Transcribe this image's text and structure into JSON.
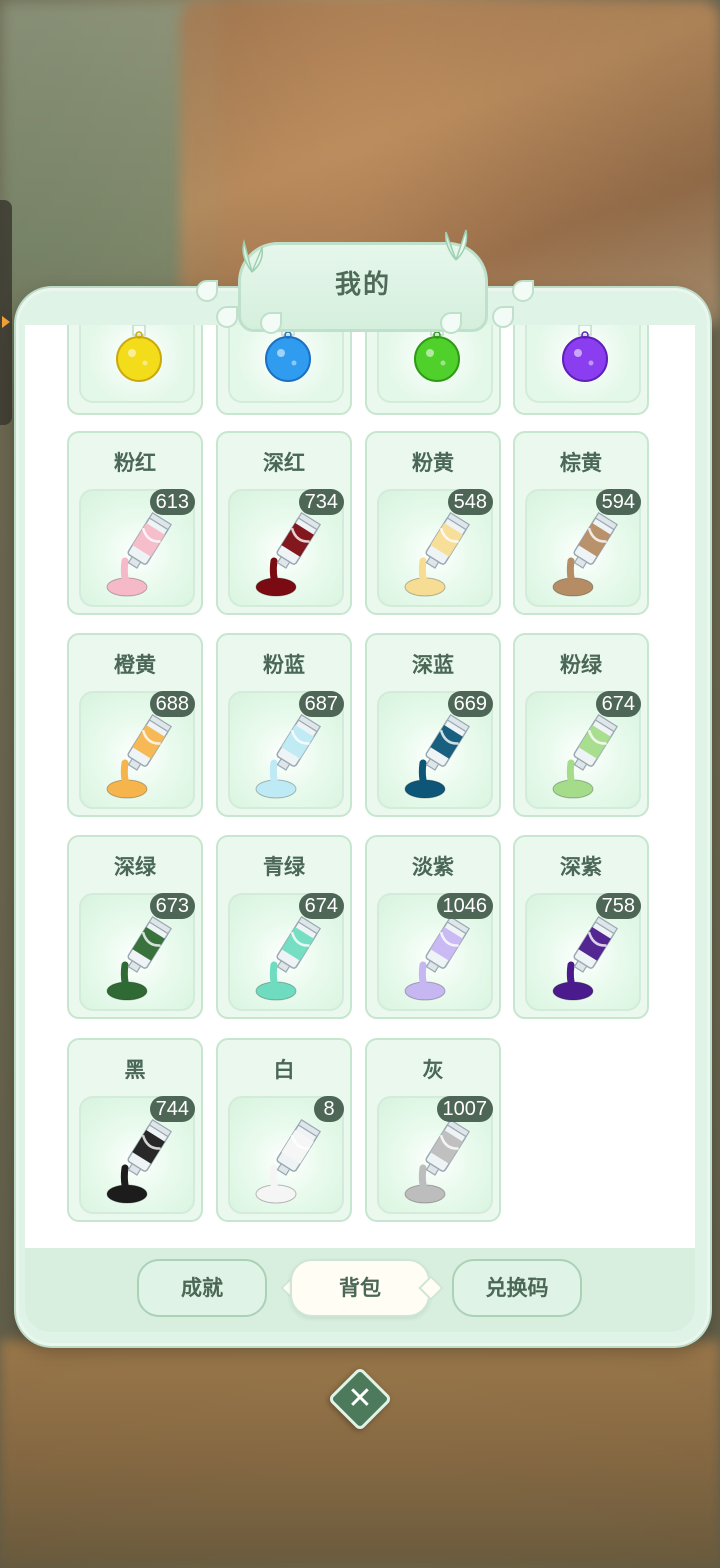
{
  "header": {
    "title": "我的"
  },
  "top_row": [
    {
      "icon": "yellow-potion-flask-icon",
      "color": "#f3dc1a",
      "dark": "#c9a90c"
    },
    {
      "icon": "blue-potion-flask-icon",
      "color": "#2f9cf0",
      "dark": "#1c6fc2"
    },
    {
      "icon": "green-potion-flask-icon",
      "color": "#4fd02a",
      "dark": "#2e9a16"
    },
    {
      "icon": "purple-potion-flask-icon",
      "color": "#8a3ef0",
      "dark": "#5e20b8"
    }
  ],
  "items": [
    {
      "label": "粉红",
      "count": "613",
      "icon": "pink-paint-tube-icon",
      "color": "#f6b9c8"
    },
    {
      "label": "深红",
      "count": "734",
      "icon": "dark-red-paint-tube-icon",
      "color": "#7b0b12"
    },
    {
      "label": "粉黄",
      "count": "548",
      "icon": "light-yellow-paint-tube-icon",
      "color": "#f7dc94"
    },
    {
      "label": "棕黄",
      "count": "594",
      "icon": "brown-yellow-paint-tube-icon",
      "color": "#b58c64"
    },
    {
      "label": "橙黄",
      "count": "688",
      "icon": "orange-yellow-paint-tube-icon",
      "color": "#f6b54c"
    },
    {
      "label": "粉蓝",
      "count": "687",
      "icon": "light-blue-paint-tube-icon",
      "color": "#bdeaf4"
    },
    {
      "label": "深蓝",
      "count": "669",
      "icon": "dark-blue-paint-tube-icon",
      "color": "#0d5678"
    },
    {
      "label": "粉绿",
      "count": "674",
      "icon": "light-green-paint-tube-icon",
      "color": "#a4dc8a"
    },
    {
      "label": "深绿",
      "count": "673",
      "icon": "dark-green-paint-tube-icon",
      "color": "#2f6a34"
    },
    {
      "label": "青绿",
      "count": "674",
      "icon": "teal-paint-tube-icon",
      "color": "#6fdcc0"
    },
    {
      "label": "淡紫",
      "count": "1046",
      "icon": "lavender-paint-tube-icon",
      "color": "#c6b6f2"
    },
    {
      "label": "深紫",
      "count": "758",
      "icon": "dark-purple-paint-tube-icon",
      "color": "#4b1a8c"
    },
    {
      "label": "黑",
      "count": "744",
      "icon": "black-paint-tube-icon",
      "color": "#1c1c1c"
    },
    {
      "label": "白",
      "count": "8",
      "icon": "white-paint-tube-icon",
      "color": "#f5f5f5"
    },
    {
      "label": "灰",
      "count": "1007",
      "icon": "gray-paint-tube-icon",
      "color": "#bdbdbd"
    }
  ],
  "footer": {
    "tabs": [
      {
        "label": "成就",
        "active": false
      },
      {
        "label": "背包",
        "active": true
      },
      {
        "label": "兑换码",
        "active": false
      }
    ]
  }
}
